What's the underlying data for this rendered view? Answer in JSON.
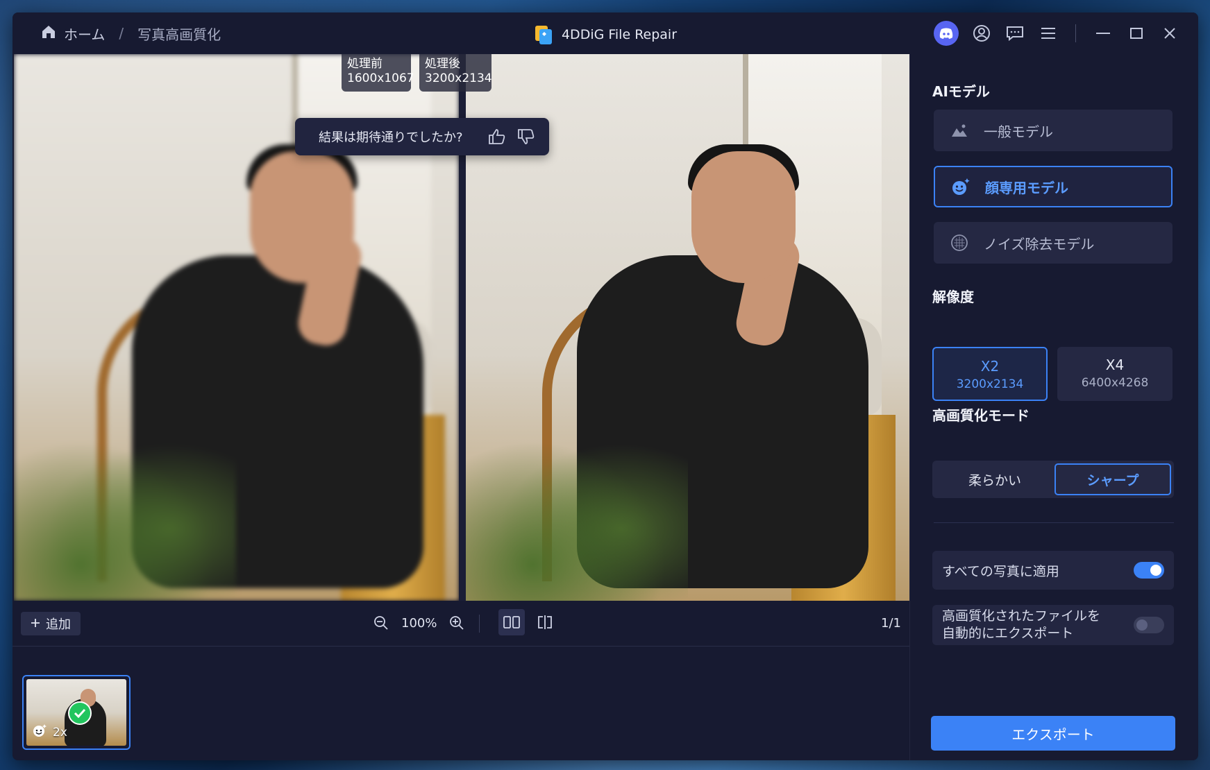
{
  "breadcrumb": {
    "home": "ホーム",
    "separator": "/",
    "current": "写真高画質化"
  },
  "app": {
    "title": "4DDiG File Repair"
  },
  "titlebar_icons": [
    "discord-icon",
    "account-icon",
    "feedback-icon",
    "menu-icon",
    "minimize-icon",
    "maximize-icon",
    "close-icon"
  ],
  "viewer": {
    "before_label": "処理前",
    "before_size": "1600x1067",
    "after_label": "処理後",
    "after_size": "3200x2134",
    "feedback_question": "結果は期待通りでしたか?"
  },
  "toolbar": {
    "add_label": "追加",
    "zoom_level": "100%",
    "page_indicator": "1/1"
  },
  "thumbnail": {
    "scale_label": "2x"
  },
  "panel": {
    "ai_model_title": "AIモデル",
    "models": [
      {
        "label": "一般モデル",
        "icon": "landscape-icon",
        "selected": false
      },
      {
        "label": "顔専用モデル",
        "icon": "face-icon",
        "selected": true
      },
      {
        "label": "ノイズ除去モデル",
        "icon": "noise-icon",
        "selected": false
      }
    ],
    "resolution_title": "解像度",
    "resolutions": [
      {
        "label": "X2",
        "size": "3200x2134",
        "selected": true
      },
      {
        "label": "X4",
        "size": "6400x4268",
        "selected": false
      }
    ],
    "mode_title": "高画質化モード",
    "modes": [
      {
        "label": "柔らかい",
        "selected": false
      },
      {
        "label": "シャープ",
        "selected": true
      }
    ],
    "apply_all_label": "すべての写真に適用",
    "apply_all_on": true,
    "auto_export_line1": "高画質化されたファイルを",
    "auto_export_line2": "自動的にエクスポート",
    "auto_export_on": false,
    "export_label": "エクスポート"
  },
  "colors": {
    "accent": "#3b82f6",
    "bg": "#171a31",
    "card": "#252843",
    "success": "#22c55e",
    "discord": "#5865f2"
  }
}
